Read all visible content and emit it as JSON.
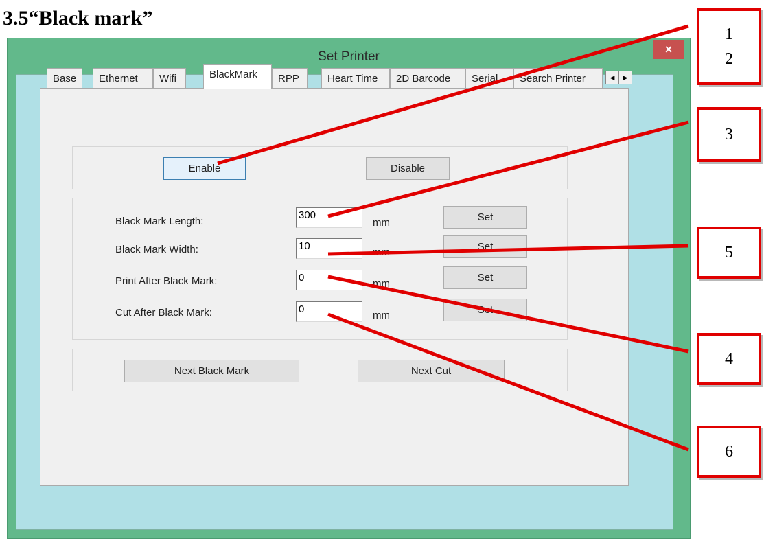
{
  "doc_heading": "3.5“Black mark”",
  "window": {
    "title": "Set Printer",
    "close_glyph": "×",
    "close_icon": "close-icon"
  },
  "tabs": [
    {
      "label": "Base"
    },
    {
      "label": "Ethernet"
    },
    {
      "label": "Wifi"
    },
    {
      "label": "BlackMark",
      "active": true
    },
    {
      "label": "RPP"
    },
    {
      "label": "Heart Time"
    },
    {
      "label": "2D Barcode"
    },
    {
      "label": "Serial"
    },
    {
      "label": "Search Printer"
    }
  ],
  "tab_scroll": {
    "left_glyph": "◀",
    "right_glyph": "▶"
  },
  "enable_group": {
    "enable_label": "Enable",
    "disable_label": "Disable"
  },
  "settings": {
    "rows": [
      {
        "label": "Black Mark Length:",
        "value": "300",
        "unit": "mm",
        "set_label": "Set"
      },
      {
        "label": "Black Mark Width:",
        "value": "10",
        "unit": "mm",
        "set_label": "Set"
      },
      {
        "label": "Print After Black Mark:",
        "value": "0",
        "unit": "mm",
        "set_label": "Set"
      },
      {
        "label": "Cut After Black Mark:",
        "value": "0",
        "unit": "mm",
        "set_label": "Set"
      }
    ]
  },
  "actions": {
    "next_black_mark_label": "Next Black Mark",
    "next_cut_label": "Next Cut"
  },
  "callouts": [
    {
      "line1": "1",
      "line2": "2"
    },
    {
      "line1": "3"
    },
    {
      "line1": "5"
    },
    {
      "line1": "4"
    },
    {
      "line1": "6"
    }
  ],
  "colors": {
    "window_frame": "#62b98b",
    "client_bg": "#b0e0e6",
    "close_button": "#c7514f",
    "callout_red": "#e00000"
  }
}
